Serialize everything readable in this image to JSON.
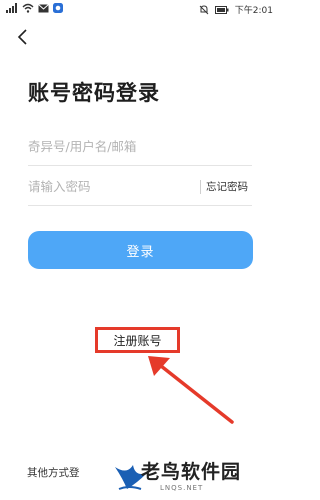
{
  "status_bar": {
    "time": "下午2:01"
  },
  "nav": {
    "back_icon": "chevron-left-icon"
  },
  "login": {
    "title": "账号密码登录",
    "username_placeholder": "奇异号/用户名/邮箱",
    "password_placeholder": "请输入密码",
    "forgot_label": "忘记密码",
    "login_button": "登录",
    "register_label": "注册账号",
    "other_methods_label": "其他方式登"
  },
  "annotation": {
    "highlight_color": "#e53a2a"
  },
  "watermark": {
    "brand": "老鸟软件园",
    "domain": "LNQS.NET"
  },
  "colors": {
    "primary": "#4ea7f7",
    "text": "#1e1e1e",
    "placeholder": "#b3b3b3"
  }
}
